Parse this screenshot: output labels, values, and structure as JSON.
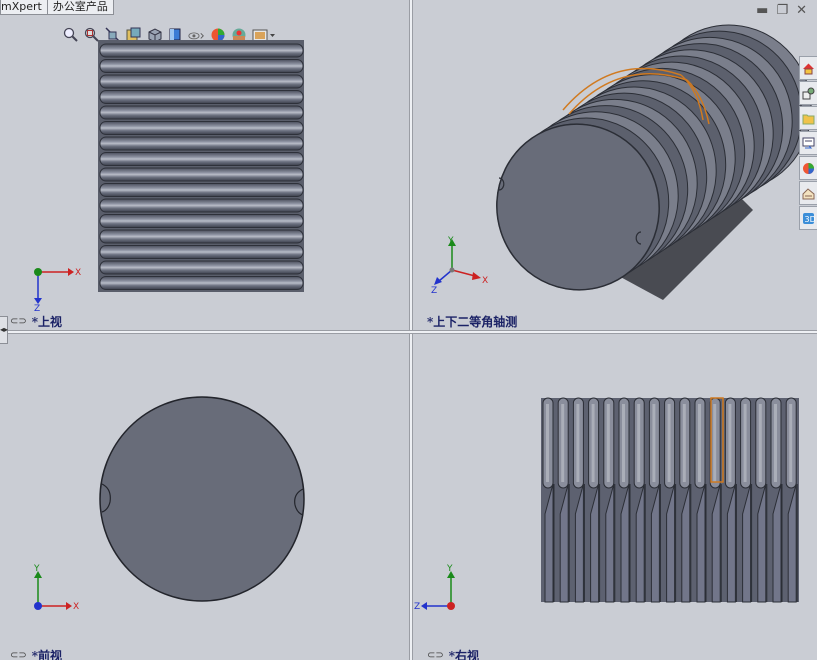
{
  "tabs": [
    {
      "label": "mXpert"
    },
    {
      "label": "办公室产品"
    }
  ],
  "viewports": {
    "top_left": {
      "label": "*上视"
    },
    "top_right": {
      "label": "*上下二等角轴测"
    },
    "bottom_left": {
      "label": "*前视"
    },
    "bottom_right": {
      "label": "*右视"
    }
  },
  "axes": {
    "x": "X",
    "y": "Y",
    "z": "Z"
  },
  "toolbar_icons": [
    "zoom-to-fit-icon",
    "zoom-area-icon",
    "section-view-icon",
    "view-orientation-icon",
    "display-style-icon",
    "hide-show-icon",
    "edit-appearance-icon",
    "apply-scene-icon",
    "view-settings-icon"
  ],
  "taskpane_icons": [
    "home-icon",
    "design-library-icon",
    "file-explorer-icon",
    "view-palette-icon",
    "appearances-icon",
    "custom-properties-icon",
    "3d-content-icon"
  ],
  "colors": {
    "viewport_bg": "#cacdd4",
    "model": "#676b78",
    "highlight": "#d07a20",
    "label": "#1b2266",
    "axis_x": "#cc2222",
    "axis_y": "#1a8a1a",
    "axis_z": "#2233cc"
  }
}
